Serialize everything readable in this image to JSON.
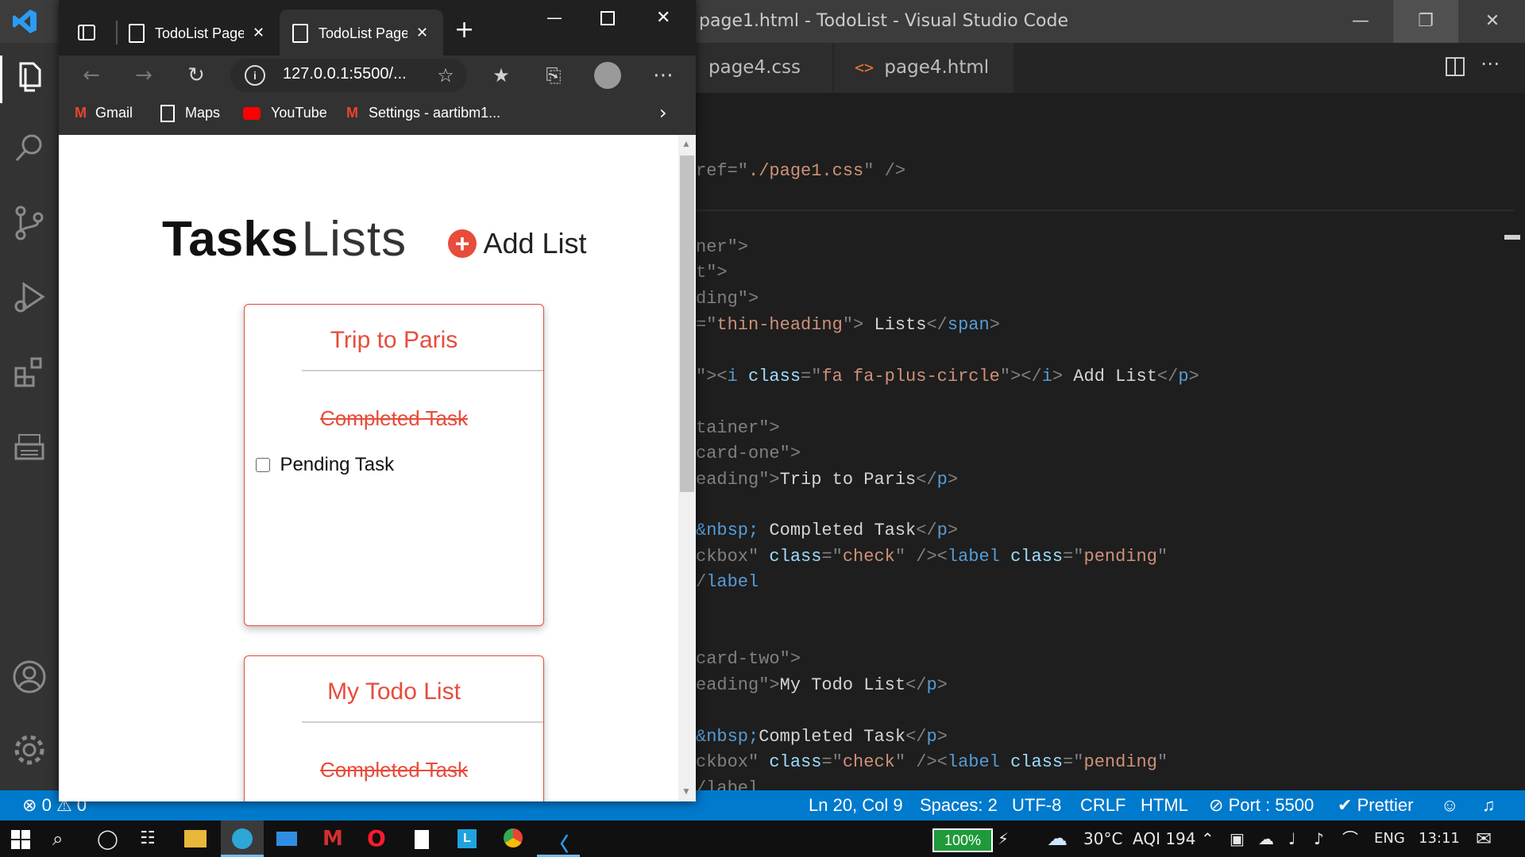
{
  "vscode": {
    "title": "page1.html - TodoList - Visual Studio Code",
    "tabs": [
      {
        "label": "page4.css"
      },
      {
        "label": "page4.html"
      }
    ],
    "code_lines": [
      {
        "parts": [
          [
            "punc",
            "ref=\""
          ],
          [
            "str",
            "./page1.css"
          ],
          [
            "punc",
            "\" />"
          ]
        ]
      },
      {
        "parts": [
          [
            "punc",
            "ner\">"
          ]
        ]
      },
      {
        "parts": [
          [
            "punc",
            "t\">"
          ]
        ]
      },
      {
        "parts": [
          [
            "punc",
            "ding\">"
          ]
        ]
      },
      {
        "parts": [
          [
            "punc",
            "=\""
          ],
          [
            "str",
            "thin-heading"
          ],
          [
            "punc",
            "\">"
          ],
          [
            "text",
            " Lists"
          ],
          [
            "punc",
            "</"
          ],
          [
            "tag",
            "span"
          ],
          [
            "punc",
            ">"
          ]
        ]
      },
      {
        "parts": [
          [
            "punc",
            "\"><"
          ],
          [
            "tag",
            "i"
          ],
          [
            "text",
            " "
          ],
          [
            "attr",
            "class"
          ],
          [
            "punc",
            "=\""
          ],
          [
            "str",
            "fa fa-plus-circle"
          ],
          [
            "punc",
            "\"></"
          ],
          [
            "tag",
            "i"
          ],
          [
            "punc",
            ">"
          ],
          [
            "text",
            " Add List"
          ],
          [
            "punc",
            "</"
          ],
          [
            "tag",
            "p"
          ],
          [
            "punc",
            ">"
          ]
        ]
      },
      {
        "parts": [
          [
            "punc",
            "tainer\">"
          ]
        ]
      },
      {
        "parts": [
          [
            "punc",
            "card-one\">"
          ]
        ]
      },
      {
        "parts": [
          [
            "punc",
            "eading\">"
          ],
          [
            "text",
            "Trip to Paris"
          ],
          [
            "punc",
            "</"
          ],
          [
            "tag",
            "p"
          ],
          [
            "punc",
            ">"
          ]
        ]
      },
      {
        "parts": [
          [
            "tag",
            "&nbsp;"
          ],
          [
            "text",
            " Completed Task"
          ],
          [
            "punc",
            "</"
          ],
          [
            "tag",
            "p"
          ],
          [
            "punc",
            ">"
          ]
        ]
      },
      {
        "parts": [
          [
            "punc",
            "ckbox\" "
          ],
          [
            "attr",
            "class"
          ],
          [
            "punc",
            "=\""
          ],
          [
            "str",
            "check"
          ],
          [
            "punc",
            "\" /><"
          ],
          [
            "tag",
            "label"
          ],
          [
            "text",
            " "
          ],
          [
            "attr",
            "class"
          ],
          [
            "punc",
            "=\""
          ],
          [
            "str",
            "pending"
          ],
          [
            "punc",
            "\""
          ]
        ]
      },
      {
        "parts": [
          [
            "punc",
            "/"
          ],
          [
            "tag",
            "label"
          ]
        ]
      },
      {
        "parts": [
          [
            "punc",
            "card-two\">"
          ]
        ]
      },
      {
        "parts": [
          [
            "punc",
            "eading\">"
          ],
          [
            "text",
            "My Todo List"
          ],
          [
            "punc",
            "</"
          ],
          [
            "tag",
            "p"
          ],
          [
            "punc",
            ">"
          ]
        ]
      },
      {
        "parts": [
          [
            "tag",
            "&nbsp;"
          ],
          [
            "text",
            "Completed Task"
          ],
          [
            "punc",
            "</"
          ],
          [
            "tag",
            "p"
          ],
          [
            "punc",
            ">"
          ]
        ]
      },
      {
        "parts": [
          [
            "punc",
            "ckbox\" "
          ],
          [
            "attr",
            "class"
          ],
          [
            "punc",
            "=\""
          ],
          [
            "str",
            "check"
          ],
          [
            "punc",
            "\" /><"
          ],
          [
            "tag",
            "label"
          ],
          [
            "text",
            " "
          ],
          [
            "attr",
            "class"
          ],
          [
            "punc",
            "=\""
          ],
          [
            "str",
            "pending"
          ],
          [
            "punc",
            "\""
          ]
        ]
      },
      {
        "parts": [
          [
            "punc",
            "/label"
          ]
        ]
      }
    ],
    "status": {
      "errors": "0",
      "warnings": "0",
      "position": "Ln 20, Col 9",
      "spaces": "Spaces: 2",
      "encoding": "UTF-8",
      "eol": "CRLF",
      "language": "HTML",
      "port": "Port : 5500",
      "prettier": "Prettier"
    }
  },
  "browser": {
    "tabs": [
      {
        "label": "TodoList Page"
      },
      {
        "label": "TodoList Page"
      }
    ],
    "url": "127.0.0.1:5500/...",
    "bookmarks": [
      "Gmail",
      "Maps",
      "YouTube",
      "Settings - aartibm1..."
    ]
  },
  "app": {
    "heading_bold": "Tasks",
    "heading_thin": "Lists",
    "add_list": "Add List",
    "cards": [
      {
        "title": "Trip to Paris",
        "completed": "Completed Task",
        "pending": "Pending Task"
      },
      {
        "title": "My Todo List",
        "completed": "Completed Task"
      }
    ]
  },
  "taskbar": {
    "battery": "100%",
    "temperature": "30°C",
    "aqi": "AQI 194",
    "language": "ENG",
    "time": "13:11"
  },
  "colors": {
    "vscode_accent": "#007acc",
    "todo_accent": "#e74c3c"
  }
}
